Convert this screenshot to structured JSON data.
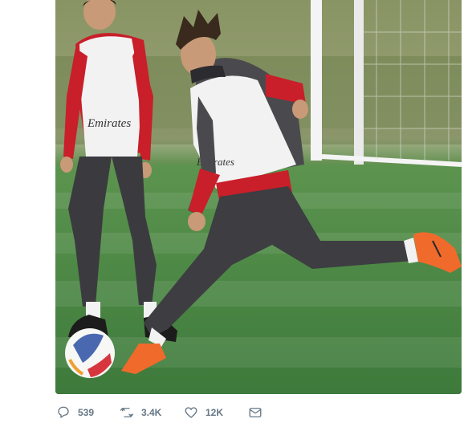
{
  "tweet": {
    "photo": {
      "alt_icon": "photo",
      "colors": {
        "grass": "#4d8a4a",
        "sky": "#c9d2b8",
        "kit_red": "#d4202a",
        "bib": "#f2f2f2",
        "boot": "#f06a2c"
      },
      "bib_text": "Emirates"
    },
    "actions": {
      "reply": {
        "icon": "reply-icon",
        "count": "539"
      },
      "retweet": {
        "icon": "retweet-icon",
        "count": "3.4K"
      },
      "like": {
        "icon": "heart-icon",
        "count": "12K"
      },
      "dm": {
        "icon": "mail-icon"
      }
    }
  }
}
